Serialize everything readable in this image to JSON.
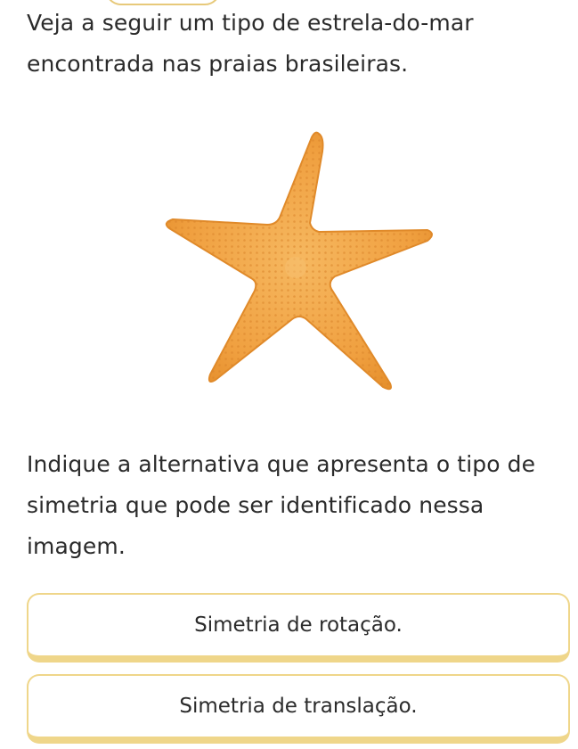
{
  "question": {
    "intro": "Veja a seguir um tipo de estrela-do-mar encontrada nas praias brasileiras.",
    "prompt": "Indique a alternativa que apresenta o tipo de simetria que pode ser identificado nessa imagem."
  },
  "image": {
    "icon": "starfish-icon",
    "color": "#f0a040"
  },
  "options": [
    {
      "label": "Simetria de rotação."
    },
    {
      "label": "Simetria de translação."
    }
  ],
  "colors": {
    "option_border": "#efd68a",
    "text": "#2b2b2b"
  }
}
